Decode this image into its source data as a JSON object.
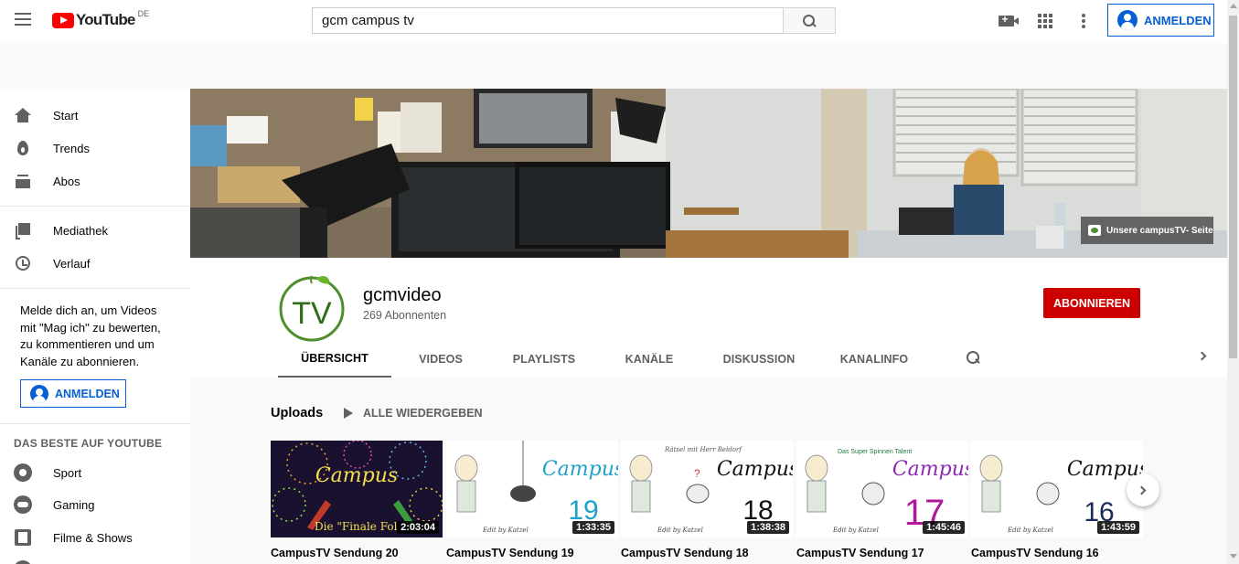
{
  "header": {
    "logo_text": "YouTube",
    "region": "DE",
    "search_value": "gcm campus tv",
    "signin_label": "ANMELDEN"
  },
  "sidebar": {
    "items": [
      {
        "label": "Start",
        "icon": "home-icon"
      },
      {
        "label": "Trends",
        "icon": "trending-icon"
      },
      {
        "label": "Abos",
        "icon": "subscriptions-icon"
      },
      {
        "label": "Mediathek",
        "icon": "library-icon"
      },
      {
        "label": "Verlauf",
        "icon": "history-icon"
      }
    ],
    "signin_message": "Melde dich an, um Videos mit \"Mag ich\" zu bewerten, zu kommentieren und um Kanäle zu abonnieren.",
    "signin_label": "ANMELDEN",
    "best_of_header": "DAS BESTE AUF YOUTUBE",
    "best_of": [
      {
        "label": "Sport",
        "icon": "sport-icon"
      },
      {
        "label": "Gaming",
        "icon": "gaming-icon"
      },
      {
        "label": "Filme & Shows",
        "icon": "film-icon"
      }
    ]
  },
  "banner": {
    "link_label": "Unsere campusTV- Seite"
  },
  "channel": {
    "name": "gcmvideo",
    "subscribers": "269 Abonnenten",
    "avatar_text": "TV",
    "subscribe_label": "ABONNIEREN",
    "tabs": [
      "ÜBERSICHT",
      "VIDEOS",
      "PLAYLISTS",
      "KANÄLE",
      "DISKUSSION",
      "KANALINFO"
    ],
    "active_tab": "ÜBERSICHT"
  },
  "uploads": {
    "title": "Uploads",
    "play_all_label": "ALLE WIEDERGEBEN",
    "videos": [
      {
        "title": "CampusTV Sendung 20",
        "duration": "2:03:04",
        "thumb_text": "Campus",
        "thumb_caption": "Die \"Finale Fol"
      },
      {
        "title": "CampusTV Sendung 19",
        "duration": "1:33:35",
        "thumb_number": "19",
        "thumb_caption": "Edit by Katzel"
      },
      {
        "title": "CampusTV Sendung 18",
        "duration": "1:38:38",
        "thumb_number": "18",
        "thumb_header": "Rätsel mit Herr Beldorf",
        "thumb_caption": "Edit by Katzel"
      },
      {
        "title": "CampusTV Sendung 17",
        "duration": "1:45:46",
        "thumb_number": "17",
        "thumb_header": "Das Super Spinnen Talent",
        "thumb_caption": "Edit by Katzel"
      },
      {
        "title": "CampusTV Sendung 16",
        "duration": "1:43:59",
        "thumb_number": "16",
        "thumb_caption": "Edit by Katzel"
      }
    ]
  },
  "colors": {
    "accent_blue": "#065fd4",
    "subscribe_red": "#cc0000",
    "logo_red": "#ff0000"
  }
}
